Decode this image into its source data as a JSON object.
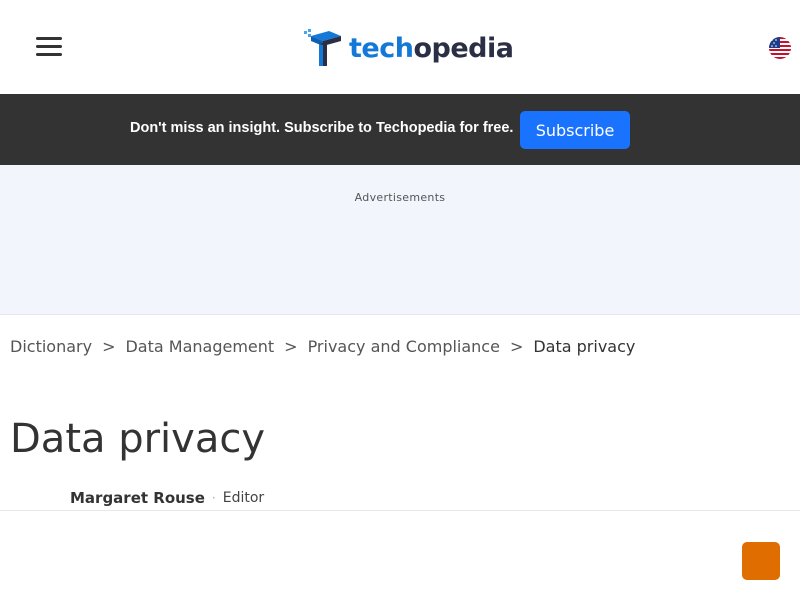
{
  "header": {
    "menu_icon": "hamburger-menu-icon",
    "logo": {
      "part1": "tech",
      "part2": "opedia"
    },
    "locale_icon": "us-flag-icon"
  },
  "promo": {
    "text": "Don't miss an insight. Subscribe to Techopedia for free.",
    "button_label": "Subscribe"
  },
  "ad": {
    "label": "Advertisements"
  },
  "breadcrumb": {
    "items": [
      "Dictionary",
      "Data Management",
      "Privacy and Compliance"
    ],
    "current": "Data privacy",
    "separator": ">"
  },
  "article": {
    "title": "Data privacy",
    "author_name": "Margaret Rouse",
    "author_role": "Editor",
    "author_separator": "·"
  },
  "colors": {
    "brand_blue": "#1479d6",
    "brand_dark": "#2a2f45",
    "promo_bg": "#333333",
    "subscribe_bg": "#1a73ff",
    "ad_bg": "#f2f5fc",
    "floating_button": "#e06d00"
  }
}
